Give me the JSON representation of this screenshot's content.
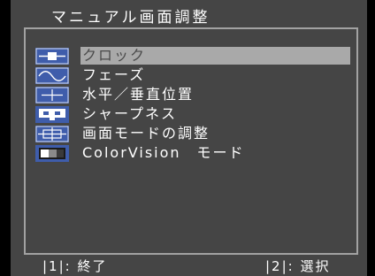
{
  "screen": {
    "title": "マニュアル画面調整"
  },
  "menu": {
    "selected_index": 0,
    "items": [
      {
        "label": "クロック",
        "icon": "clock-icon"
      },
      {
        "label": "フェーズ",
        "icon": "phase-icon"
      },
      {
        "label": "水平／垂直位置",
        "icon": "position-icon"
      },
      {
        "label": "シャープネス",
        "icon": "sharpness-icon"
      },
      {
        "label": "画面モードの調整",
        "icon": "screen-mode-icon"
      },
      {
        "label": "ColorVision　モード",
        "icon": "colorvision-icon"
      }
    ]
  },
  "footer": {
    "exit_hint": "|1|: 終了",
    "select_hint": "|2|: 選択"
  },
  "colors": {
    "screen_background": "#000000",
    "osd_background": "#454545",
    "frame": "#a2a2a2",
    "selection_highlight": "#a9a9a9",
    "icon_fill": "#3f5dab",
    "text": "#ffffff"
  }
}
